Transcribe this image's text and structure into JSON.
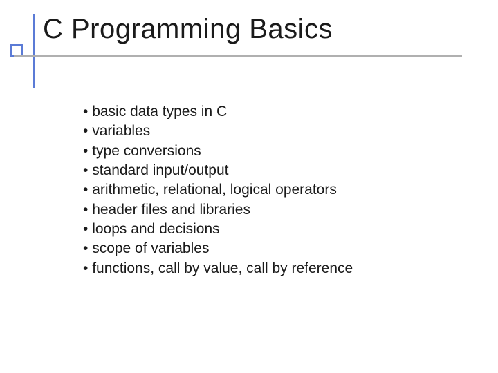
{
  "title": "C Programming Basics",
  "bullets": {
    "0": "basic data types in C",
    "1": "variables",
    "2": "type conversions",
    "3": "standard input/output",
    "4": "arithmetic, relational, logical operators",
    "5": "header files and libraries",
    "6": "loops and decisions",
    "7": "scope of variables",
    "8": "functions, call by value, call by reference"
  }
}
